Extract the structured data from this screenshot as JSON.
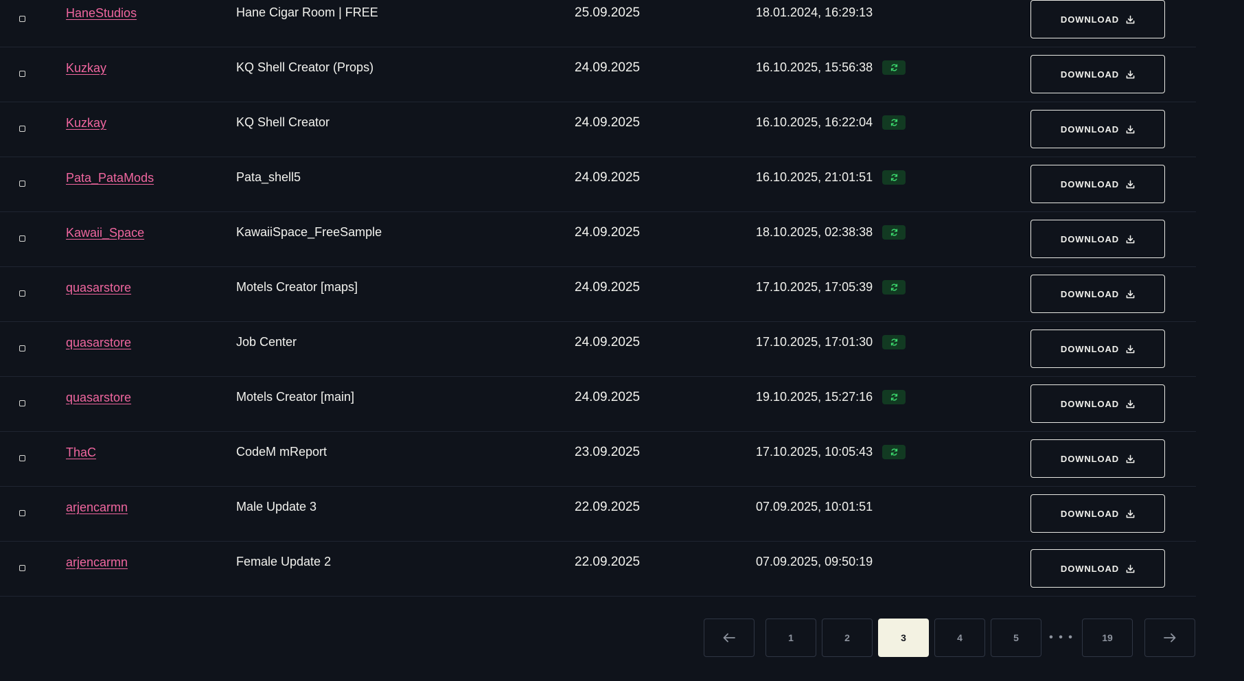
{
  "rows": [
    {
      "author": "HaneStudios",
      "asset": "Hane Cigar Room | FREE",
      "date": "25.09.2025",
      "updated": "18.01.2024, 16:29:13",
      "synced": false,
      "button": "DOWNLOAD"
    },
    {
      "author": "Kuzkay",
      "asset": "KQ Shell Creator (Props)",
      "date": "24.09.2025",
      "updated": "16.10.2025, 15:56:38",
      "synced": true,
      "button": "DOWNLOAD"
    },
    {
      "author": "Kuzkay",
      "asset": "KQ Shell Creator",
      "date": "24.09.2025",
      "updated": "16.10.2025, 16:22:04",
      "synced": true,
      "button": "DOWNLOAD"
    },
    {
      "author": "Pata_PataMods",
      "asset": "Pata_shell5",
      "date": "24.09.2025",
      "updated": "16.10.2025, 21:01:51",
      "synced": true,
      "button": "DOWNLOAD"
    },
    {
      "author": "Kawaii_Space",
      "asset": "KawaiiSpace_FreeSample",
      "date": "24.09.2025",
      "updated": "18.10.2025, 02:38:38",
      "synced": true,
      "button": "DOWNLOAD"
    },
    {
      "author": "quasarstore",
      "asset": "Motels Creator [maps]",
      "date": "24.09.2025",
      "updated": "17.10.2025, 17:05:39",
      "synced": true,
      "button": "DOWNLOAD"
    },
    {
      "author": "quasarstore",
      "asset": "Job Center",
      "date": "24.09.2025",
      "updated": "17.10.2025, 17:01:30",
      "synced": true,
      "button": "DOWNLOAD"
    },
    {
      "author": "quasarstore",
      "asset": "Motels Creator [main]",
      "date": "24.09.2025",
      "updated": "19.10.2025, 15:27:16",
      "synced": true,
      "button": "DOWNLOAD"
    },
    {
      "author": "ThaC",
      "asset": "CodeM mReport",
      "date": "23.09.2025",
      "updated": "17.10.2025, 10:05:43",
      "synced": true,
      "button": "DOWNLOAD"
    },
    {
      "author": "arjencarmn",
      "asset": "Male Update 3",
      "date": "22.09.2025",
      "updated": "07.09.2025, 10:01:51",
      "synced": false,
      "button": "DOWNLOAD"
    },
    {
      "author": "arjencarmn",
      "asset": "Female Update 2",
      "date": "22.09.2025",
      "updated": "07.09.2025, 09:50:19",
      "synced": false,
      "button": "DOWNLOAD"
    }
  ],
  "pagination": {
    "prev_icon": "arrow-left-icon",
    "next_icon": "arrow-right-icon",
    "pages": [
      "1",
      "2",
      "3",
      "4",
      "5"
    ],
    "current": "3",
    "ellipsis": "• • •",
    "last": "19"
  },
  "colors": {
    "background": "#0f131b",
    "author_link": "#f0669f",
    "sync_badge_bg": "#123a22",
    "sync_icon": "#3ddc6f",
    "active_page": "#f3f2e2"
  },
  "icons": {
    "sync": "sync-icon",
    "download": "download-icon",
    "checkbox": "checkbox-icon"
  }
}
